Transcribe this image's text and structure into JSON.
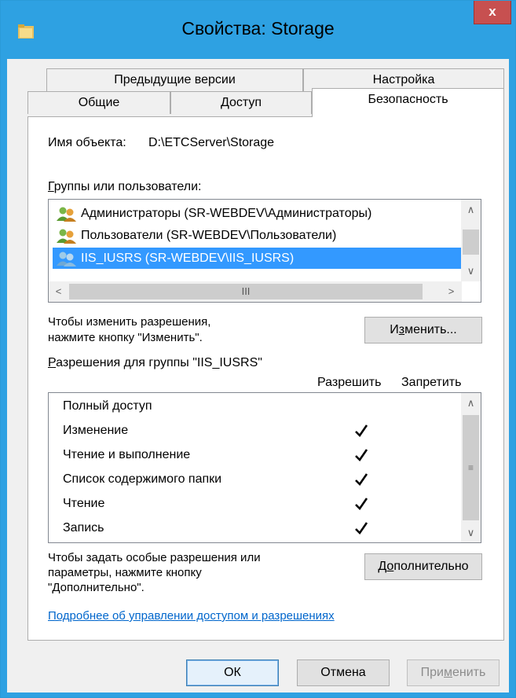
{
  "window": {
    "title": "Свойства: Storage",
    "close_label": "x"
  },
  "tabs": {
    "row1": [
      "Предыдущие версии",
      "Настройка"
    ],
    "row2": [
      "Общие",
      "Доступ",
      "Безопасность"
    ],
    "active": "Безопасность"
  },
  "object": {
    "label": "Имя объекта:",
    "value": "D:\\ETCServer\\Storage"
  },
  "groups": {
    "label_prefix": "Г",
    "label_rest": "руппы или пользователи:",
    "items": [
      "Администраторы (SR-WEBDEV\\Администраторы)",
      "Пользователи (SR-WEBDEV\\Пользователи)",
      "IIS_IUSRS (SR-WEBDEV\\IIS_IUSRS)"
    ],
    "selected_index": 2,
    "hscroll_thumb_glyph": "III"
  },
  "change": {
    "hint_line1": "Чтобы изменить разрешения,",
    "hint_line2": "нажмите кнопку \"Изменить\".",
    "button_pre": "И",
    "button_u": "з",
    "button_post": "менить..."
  },
  "permissions": {
    "label_prefix": "Р",
    "label_rest": "азрешения для группы \"IIS_IUSRS\"",
    "col_allow": "Разрешить",
    "col_deny": "Запретить",
    "rows": [
      {
        "name": "Полный доступ",
        "allow": false,
        "deny": false
      },
      {
        "name": "Изменение",
        "allow": true,
        "deny": false
      },
      {
        "name": "Чтение и выполнение",
        "allow": true,
        "deny": false
      },
      {
        "name": "Список содержимого папки",
        "allow": true,
        "deny": false
      },
      {
        "name": "Чтение",
        "allow": true,
        "deny": false
      },
      {
        "name": "Запись",
        "allow": true,
        "deny": false
      }
    ]
  },
  "advanced": {
    "hint_line1": "Чтобы задать особые разрешения или",
    "hint_line2": "параметры, нажмите кнопку",
    "hint_line3": "\"Дополнительно\".",
    "button_pre": "Д",
    "button_u": "о",
    "button_post": "полнительно"
  },
  "help_link": "Подробнее об управлении доступом и разрешениях",
  "footer": {
    "ok": "ОК",
    "cancel": "Отмена",
    "apply_pre": "При",
    "apply_u": "м",
    "apply_post": "енить"
  },
  "colors": {
    "titlebar": "#2ea1e2",
    "close": "#c75050",
    "selection": "#3399ff",
    "link": "#0066cc"
  }
}
